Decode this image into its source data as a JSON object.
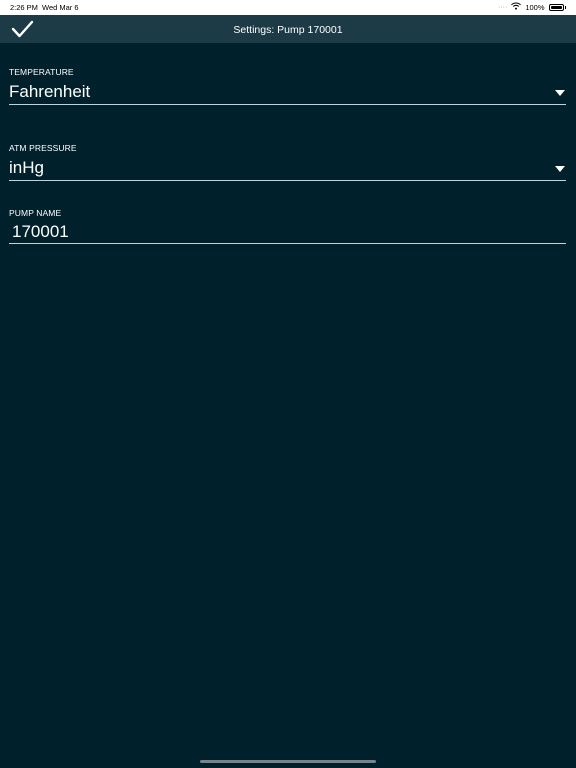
{
  "status_bar": {
    "time": "2:26 PM",
    "date": "Wed Mar 6",
    "battery": "100%",
    "icons": [
      "signal-dots-icon",
      "wifi-icon",
      "battery-icon"
    ]
  },
  "nav": {
    "title": "Settings: Pump 170001",
    "done_icon": "checkmark-icon"
  },
  "fields": {
    "temperature": {
      "label": "TEMPERATURE",
      "value": "Fahrenheit"
    },
    "atm_pressure": {
      "label": "ATM PRESSURE",
      "value": "inHg"
    },
    "pump_name": {
      "label": "PUMP NAME",
      "value": "170001"
    }
  },
  "colors": {
    "background": "#00202c",
    "nav_bar": "#1c3b47",
    "text": "#ffffff"
  }
}
